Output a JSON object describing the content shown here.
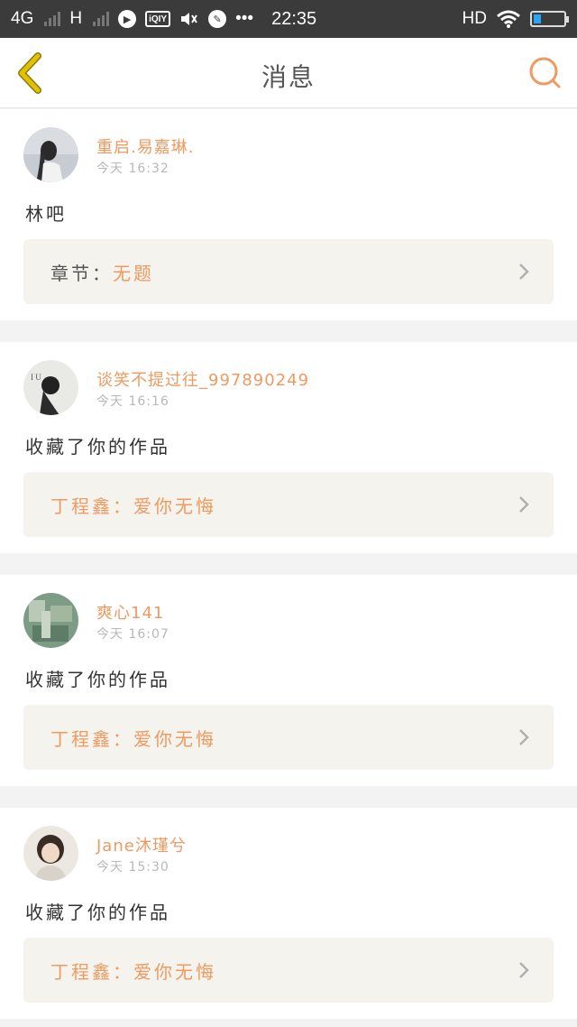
{
  "status_bar": {
    "network_1": "4G",
    "network_2": "H",
    "dots": "•••",
    "time": "22:35",
    "hd": "HD",
    "battery_level": 0.25
  },
  "header": {
    "title": "消息",
    "accent_color": "#ef9a60",
    "back_color": "#e2c100"
  },
  "messages": [
    {
      "user": "重启.易嘉琳.",
      "time": "今天 16:32",
      "text": "林吧",
      "ref_label": "章节：",
      "ref_value": "无题"
    },
    {
      "user": "谈笑不提过往_997890249",
      "time": "今天 16:16",
      "text": "收藏了你的作品",
      "ref_label": "丁程鑫：",
      "ref_value": "爱你无悔"
    },
    {
      "user": "爽心141",
      "time": "今天 16:07",
      "text": "收藏了你的作品",
      "ref_label": "丁程鑫：",
      "ref_value": "爱你无悔"
    },
    {
      "user": "Jane沐瑾兮",
      "time": "今天 15:30",
      "text": "收藏了你的作品",
      "ref_label": "丁程鑫：",
      "ref_value": "爱你无悔"
    }
  ]
}
